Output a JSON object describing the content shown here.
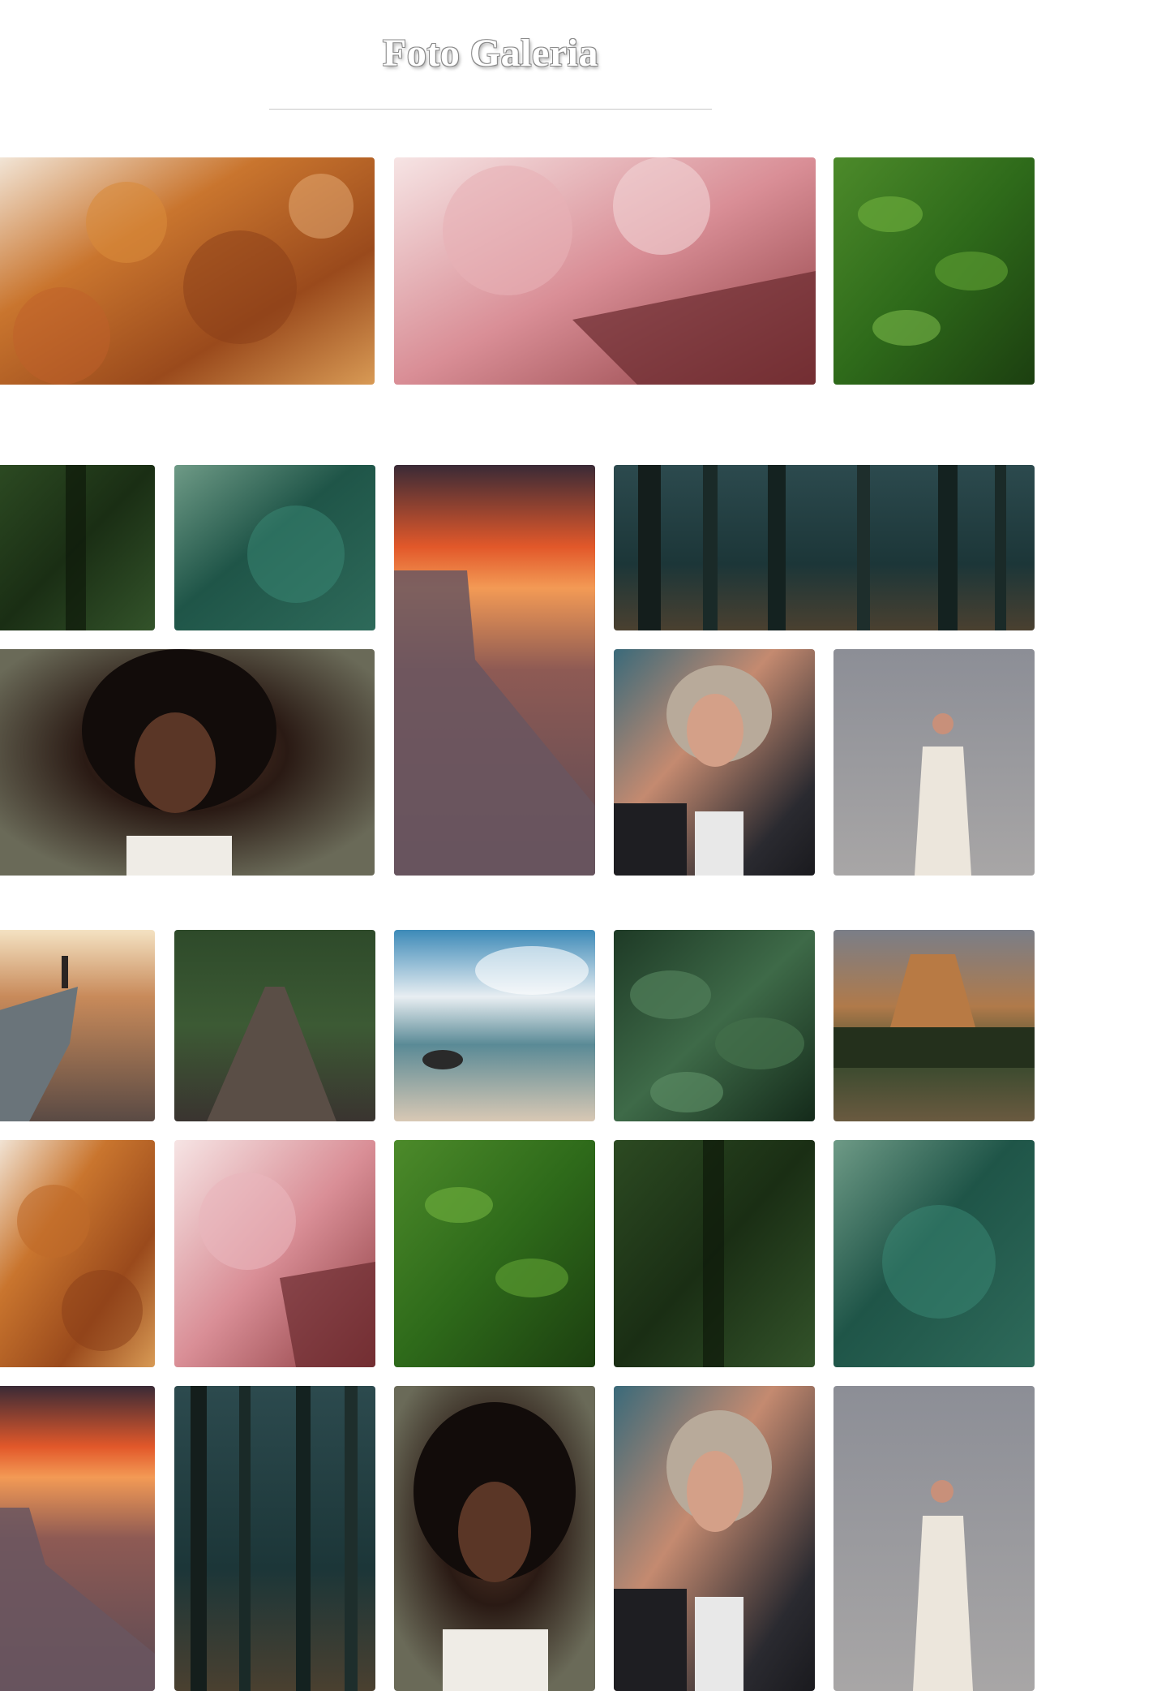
{
  "gallery": {
    "title": "Foto Galeria"
  },
  "photos": [
    {
      "id": "autumn-leaves",
      "subject": "autumn-leaves"
    },
    {
      "id": "cherry-blossom-temple",
      "subject": "cherry-blossom-temple"
    },
    {
      "id": "green-leaves",
      "subject": "green-leaves"
    },
    {
      "id": "hedge-bush",
      "subject": "hedge-bush"
    },
    {
      "id": "teal-aerial-water",
      "subject": "teal-aerial-water"
    },
    {
      "id": "sunset-cliff-sea",
      "subject": "sunset-cliff-sea"
    },
    {
      "id": "misty-forest",
      "subject": "misty-forest"
    },
    {
      "id": "portrait-curly-hair",
      "subject": "portrait-curly-hair"
    },
    {
      "id": "portrait-rollers-keyboard",
      "subject": "portrait-rollers-keyboard"
    },
    {
      "id": "woman-white-dress",
      "subject": "woman-white-dress"
    },
    {
      "id": "hiker-on-rock",
      "subject": "hiker-on-rock"
    },
    {
      "id": "forest-boardwalk",
      "subject": "forest-boardwalk"
    },
    {
      "id": "tropical-beach",
      "subject": "tropical-beach"
    },
    {
      "id": "wet-leaves",
      "subject": "wet-leaves"
    },
    {
      "id": "devils-tower",
      "subject": "devils-tower"
    }
  ]
}
